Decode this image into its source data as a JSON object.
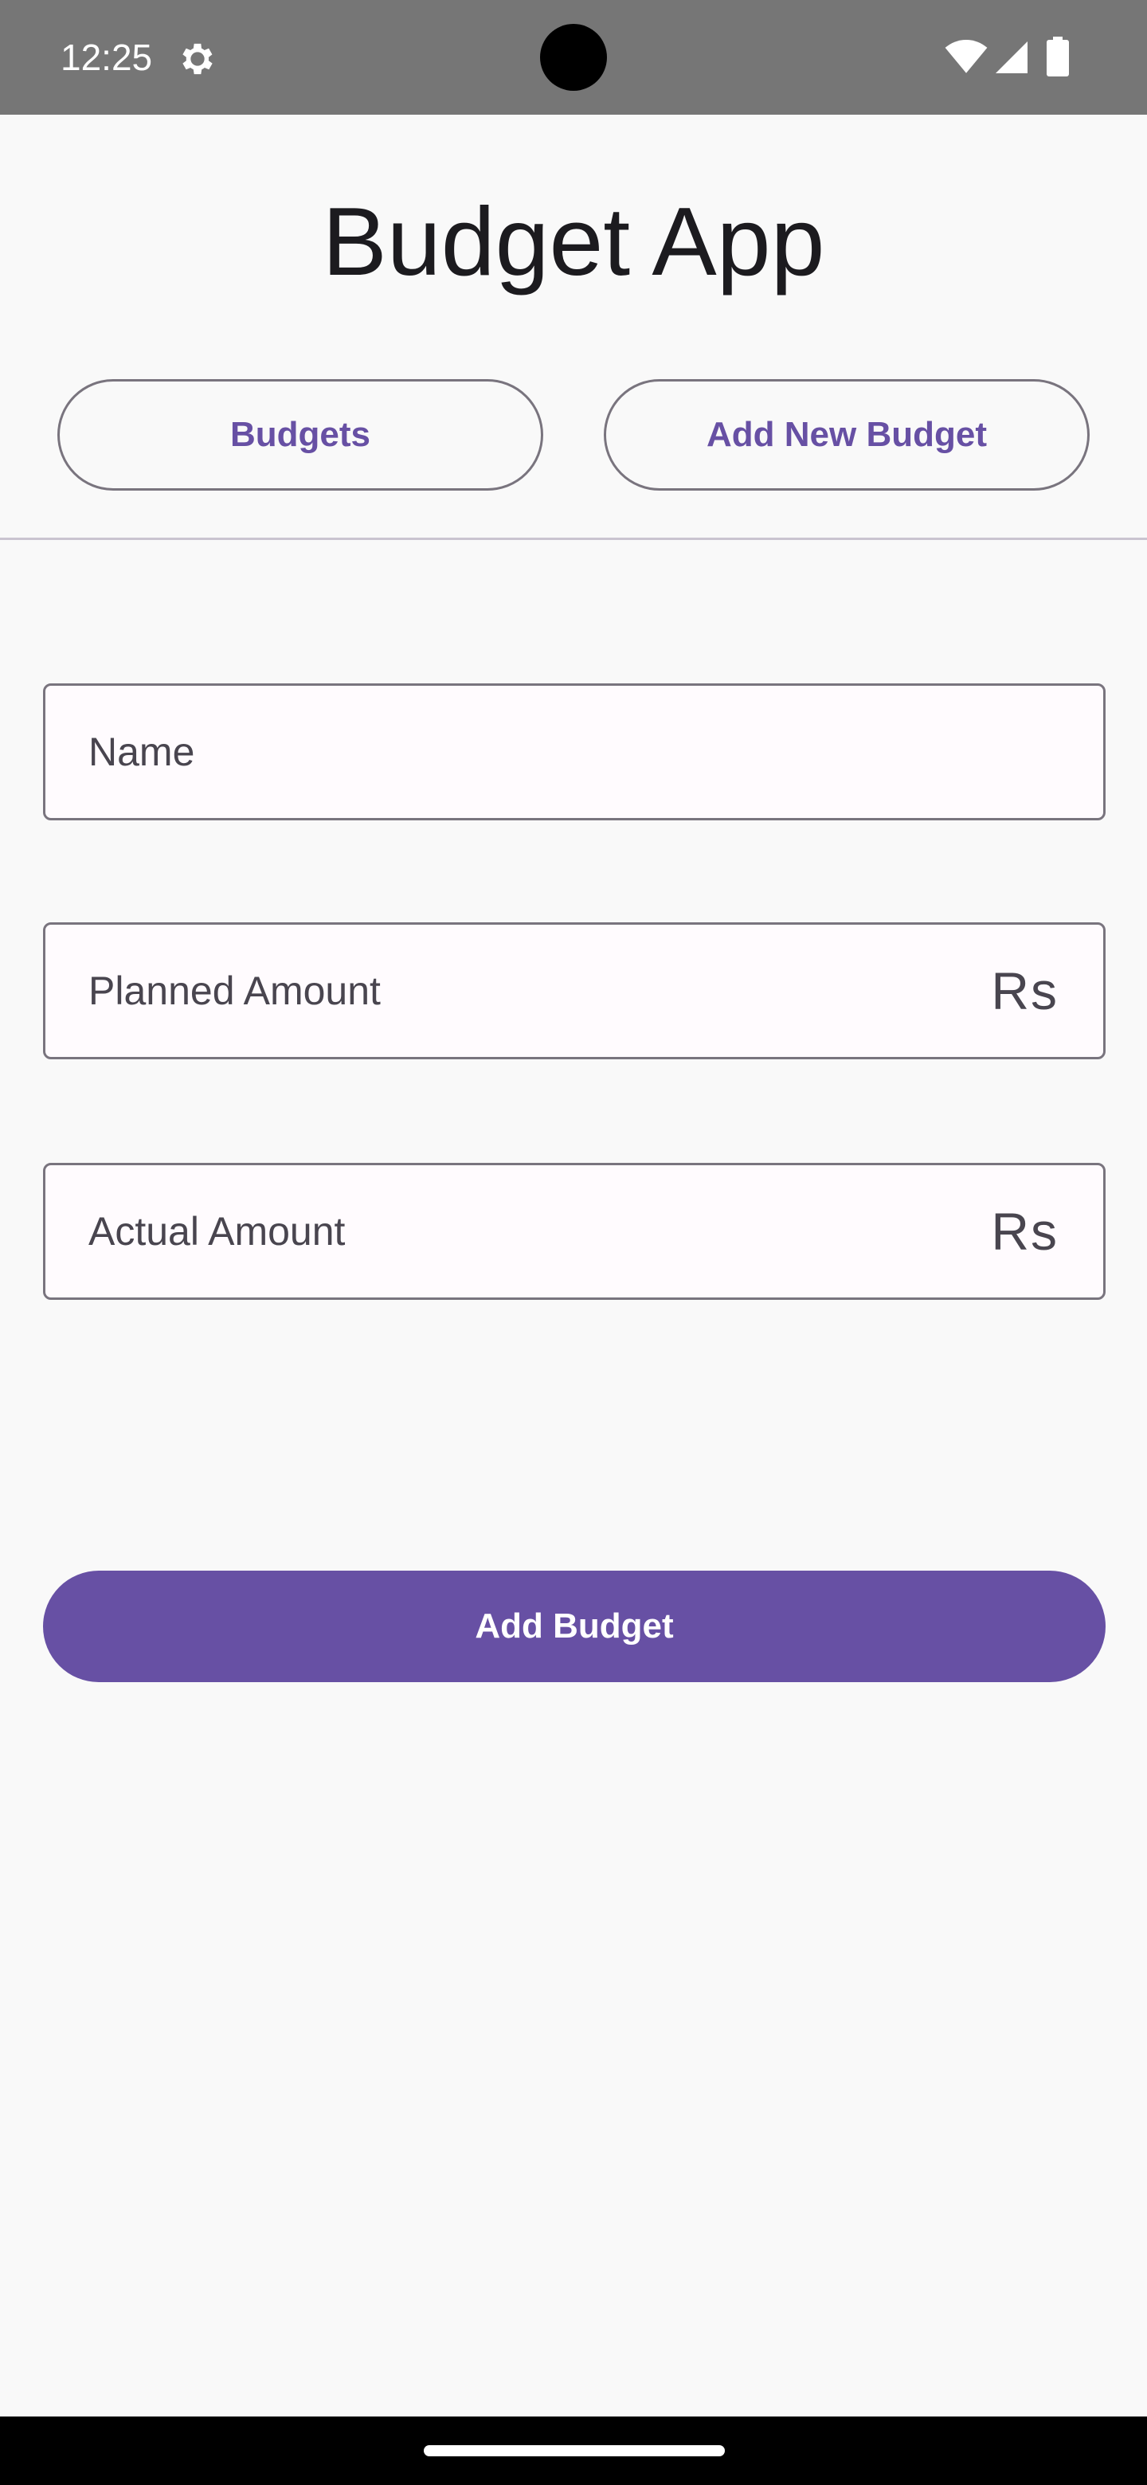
{
  "status_bar": {
    "time": "12:25",
    "icons": [
      "gear-icon",
      "wifi-icon",
      "signal-icon",
      "battery-icon"
    ]
  },
  "header": {
    "title": "Budget App"
  },
  "nav": {
    "budgets_label": "Budgets",
    "add_new_label": "Add New Budget"
  },
  "form": {
    "name": {
      "placeholder": "Name",
      "value": ""
    },
    "planned_amount": {
      "placeholder": "Planned Amount",
      "value": "",
      "suffix": "Rs"
    },
    "actual_amount": {
      "placeholder": "Actual Amount",
      "value": "",
      "suffix": "Rs"
    },
    "submit_label": "Add Budget"
  },
  "colors": {
    "primary": "#6750a4",
    "status_bar": "#767676",
    "background": "#f9f9f9",
    "outline": "#79747e"
  }
}
